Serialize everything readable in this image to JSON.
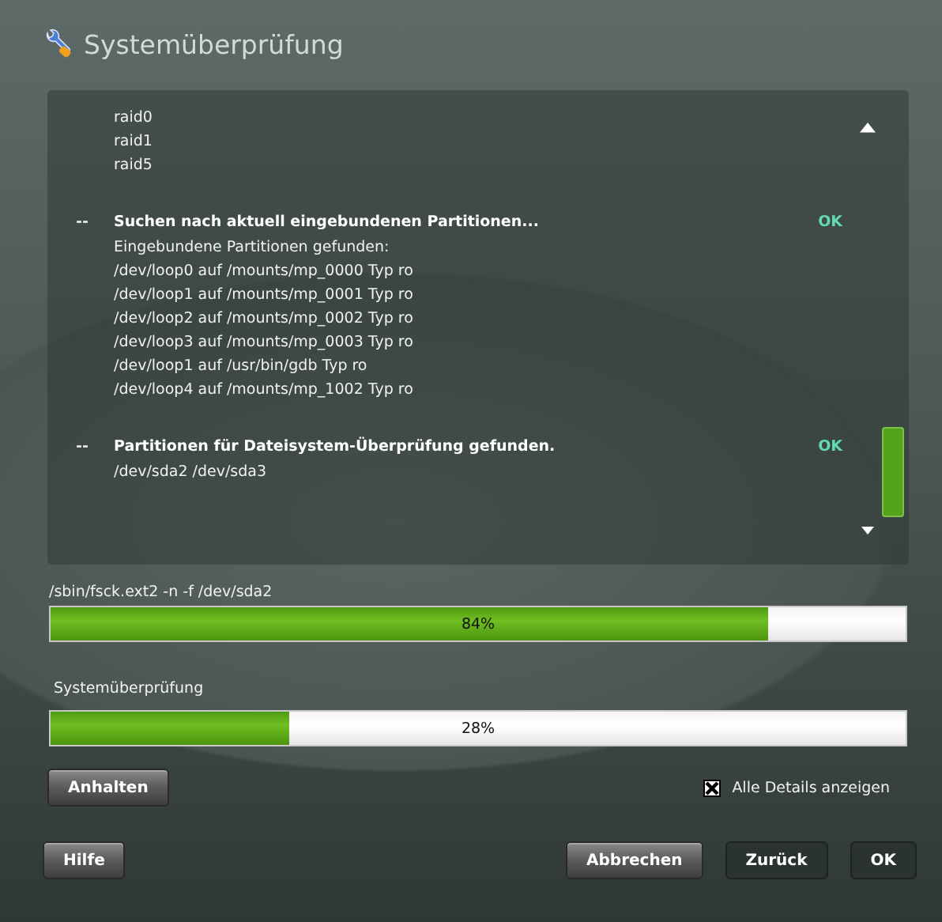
{
  "window": {
    "title": "Systemüberprüfung"
  },
  "log": [
    {
      "kind": "detail",
      "lines": [
        "raid0",
        "raid1",
        "raid5"
      ]
    },
    {
      "kind": "step",
      "marker": "--",
      "title": "Suchen nach aktuell eingebundenen Partitionen...",
      "status": "OK",
      "lines": [
        "Eingebundene Partitionen gefunden:",
        "/dev/loop0 auf /mounts/mp_0000 Typ ro",
        "/dev/loop1 auf /mounts/mp_0001 Typ ro",
        "/dev/loop2 auf /mounts/mp_0002 Typ ro",
        "/dev/loop3 auf /mounts/mp_0003 Typ ro",
        "/dev/loop1 auf /usr/bin/gdb Typ ro",
        "/dev/loop4 auf /mounts/mp_1002 Typ ro"
      ]
    },
    {
      "kind": "step",
      "marker": "--",
      "title": "Partitionen für Dateisystem-Überprüfung gefunden.",
      "status": "OK",
      "lines": [
        "/dev/sda2 /dev/sda3"
      ]
    }
  ],
  "progress": [
    {
      "label": "/sbin/fsck.ext2 -n -f /dev/sda2",
      "level": 0.84,
      "reading": "84%"
    },
    {
      "label": "Systemüberprüfung",
      "level": 0.28,
      "reading": "28%"
    }
  ],
  "stop_button": "Anhalten",
  "details_checkbox": {
    "label": "Alle Details anzeigen",
    "checked": true
  },
  "buttons": [
    {
      "label": "Hilfe",
      "kind": "raised"
    },
    {
      "label": "Abbrechen",
      "kind": "raised"
    },
    {
      "label": "Zurück",
      "kind": "flat"
    },
    {
      "label": "OK",
      "kind": "flat"
    }
  ]
}
